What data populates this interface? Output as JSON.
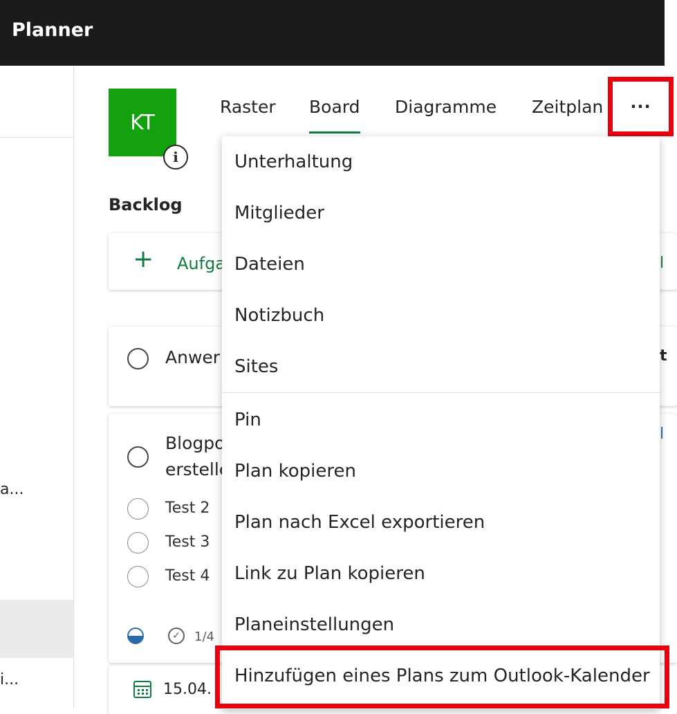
{
  "app": {
    "title": "Planner"
  },
  "plan": {
    "avatar_initials": "KT",
    "info_icon": "info-icon"
  },
  "tabs": [
    {
      "label": "Raster"
    },
    {
      "label": "Board",
      "selected": true
    },
    {
      "label": "Diagramme"
    },
    {
      "label": "Zeitplan"
    }
  ],
  "more_button": {
    "label": "···"
  },
  "left_nav": {
    "item1_fragment": "a...",
    "item2_fragment": "i..."
  },
  "bucket": {
    "title": "Backlog",
    "add_task_label": "Aufga",
    "tasks": [
      {
        "title": "Anwer"
      },
      {
        "title_line1": "Blogpo",
        "title_line2": "erstelle",
        "checklist": [
          {
            "label": "Test 2"
          },
          {
            "label": "Test 3"
          },
          {
            "label": "Test 4"
          }
        ],
        "checklist_count": "1/4"
      },
      {
        "due_date": "15.04."
      }
    ]
  },
  "edge_fragments": {
    "a": "l",
    "b": "t",
    "c": "l"
  },
  "menu": {
    "items": [
      {
        "label": "Unterhaltung"
      },
      {
        "label": "Mitglieder"
      },
      {
        "label": "Dateien"
      },
      {
        "label": "Notizbuch"
      },
      {
        "label": "Sites"
      },
      {
        "label": "Pin"
      },
      {
        "label": "Plan kopieren"
      },
      {
        "label": "Plan nach Excel exportieren"
      },
      {
        "label": "Link zu Plan kopieren"
      },
      {
        "label": "Planeinstellungen"
      },
      {
        "label": "Hinzufügen eines Plans zum Outlook-Kalender"
      }
    ]
  },
  "colors": {
    "header_bg": "#1b1b1b",
    "accent_green": "#107c41",
    "avatar_green": "#13a10e",
    "annotation_red": "#e8000e"
  }
}
